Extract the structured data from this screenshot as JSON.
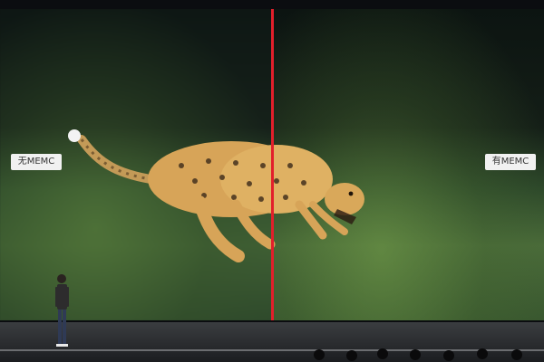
{
  "labels": {
    "left": "无MEMC",
    "right": "有MEMC"
  },
  "colors": {
    "divider": "#e21f2b"
  }
}
